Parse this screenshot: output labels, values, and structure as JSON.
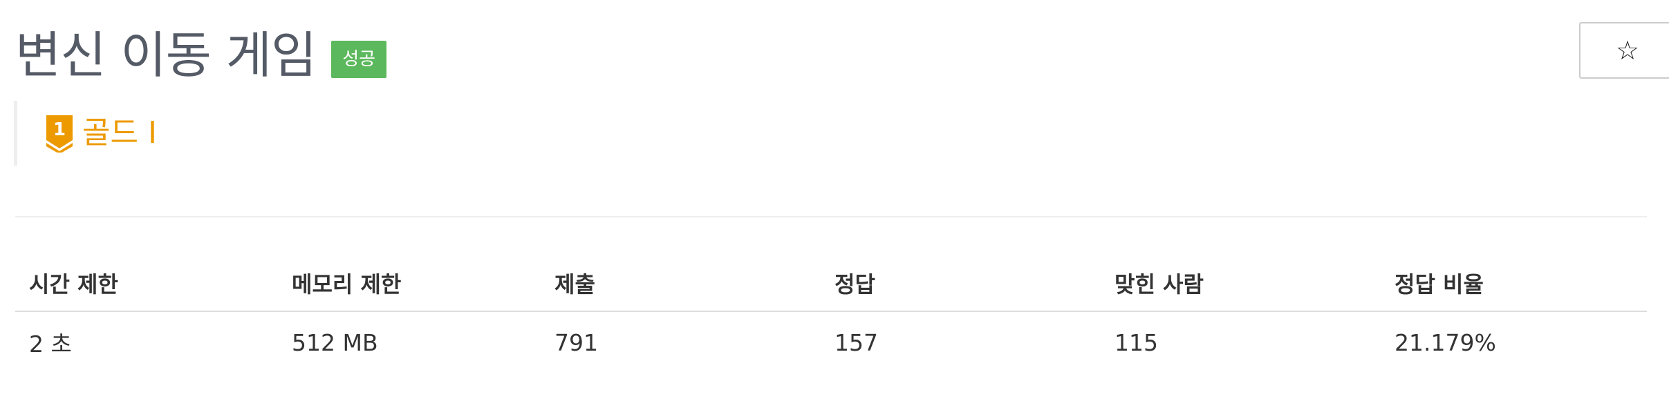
{
  "problem": {
    "title": "변신 이동 게임",
    "status_badge": "성공"
  },
  "star_button": {
    "icon": "star-outline-icon",
    "glyph": "☆"
  },
  "tier": {
    "icon": "gold-tier-1-icon",
    "badge_number": "1",
    "label": "골드 I",
    "color": "#ec9a00"
  },
  "info_table": {
    "headers": [
      "시간 제한",
      "메모리 제한",
      "제출",
      "정답",
      "맞힌 사람",
      "정답 비율"
    ],
    "row": [
      "2 초",
      "512 MB",
      "791",
      "157",
      "115",
      "21.179%"
    ]
  },
  "colors": {
    "status_badge_bg": "#5cb85c",
    "title_text": "#555b66"
  }
}
